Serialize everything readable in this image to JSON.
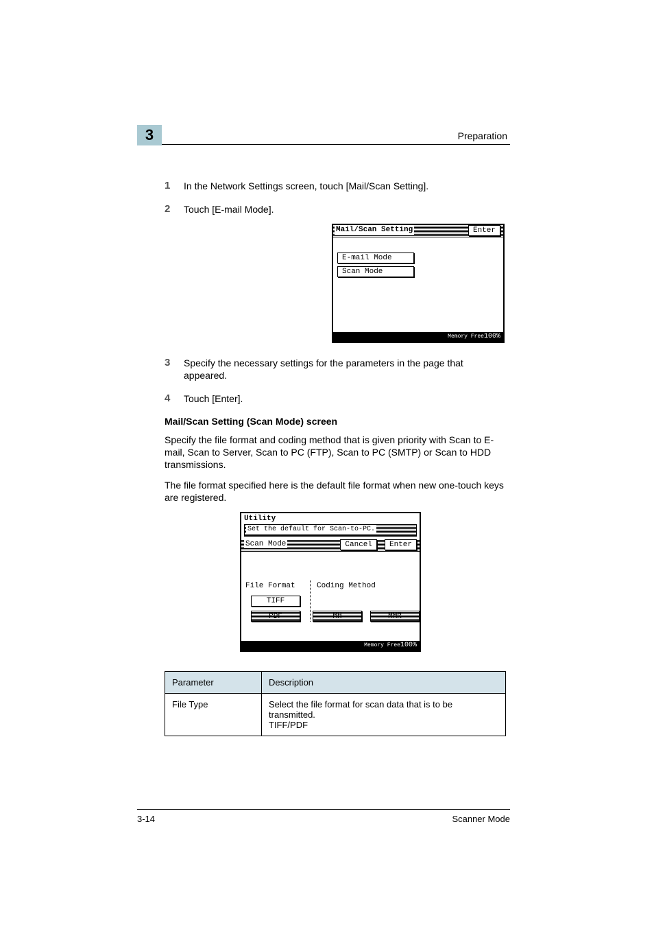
{
  "header": {
    "chapter_number": "3",
    "section_title": "Preparation"
  },
  "steps": {
    "s1": {
      "num": "1",
      "text": "In the Network Settings screen, touch [Mail/Scan Setting]."
    },
    "s2": {
      "num": "2",
      "text": "Touch [E-mail Mode]."
    },
    "s3": {
      "num": "3",
      "text": "Specify the necessary settings for the parameters in the page that appeared."
    },
    "s4": {
      "num": "4",
      "text": "Touch [Enter]."
    }
  },
  "lcd1": {
    "title": "Mail/Scan Setting",
    "enter": "Enter",
    "btn_email": "E-mail Mode",
    "btn_scan": "Scan Mode",
    "status_label": "Memory Free",
    "status_pct": "100%"
  },
  "subhead": "Mail/Scan Setting (Scan Mode) screen",
  "para1": "Specify the file format and coding method that is given priority with Scan to E-mail, Scan to Server, Scan to PC (FTP), Scan to PC (SMTP) or Scan to HDD transmissions.",
  "para2": "The file format specified here is the default file format when new one-touch keys are registered.",
  "lcd2": {
    "utility": "Utility",
    "instr": "Set the default for Scan-to-PC.",
    "scan_mode": "Scan Mode",
    "cancel": "Cancel",
    "enter": "Enter",
    "file_format_label": "File Format",
    "coding_method_label": "Coding Method",
    "tiff": "TIFF",
    "pdf": "PDF",
    "mh": "MH",
    "mmr": "MMR",
    "status_label": "Memory Free",
    "status_pct": "100%"
  },
  "table": {
    "h_param": "Parameter",
    "h_desc": "Description",
    "row1_param": "File Type",
    "row1_desc": "Select the file format for scan data that is to be transmitted.\nTIFF/PDF"
  },
  "footer": {
    "page": "3-14",
    "mode": "Scanner Mode"
  }
}
